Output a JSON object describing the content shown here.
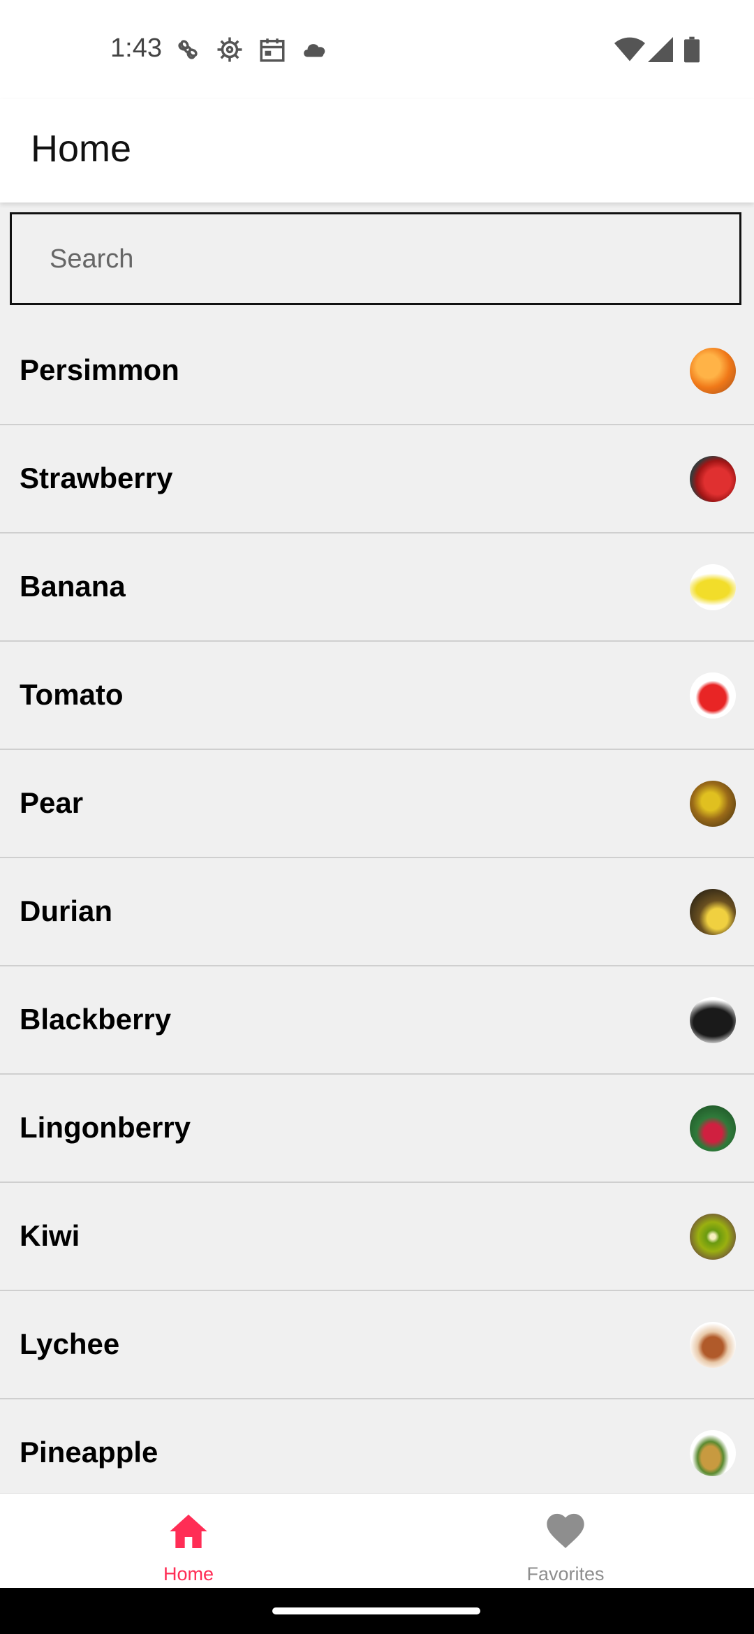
{
  "status_bar": {
    "time": "1:43",
    "icons": [
      "fan-icon",
      "settings-gear-icon",
      "calendar-icon",
      "cloud-icon",
      "wifi-icon",
      "signal-icon",
      "battery-icon"
    ]
  },
  "app_bar": {
    "title": "Home"
  },
  "search": {
    "placeholder": "Search",
    "value": ""
  },
  "list": {
    "items": [
      {
        "label": "Persimmon",
        "thumb": "persimmon-image"
      },
      {
        "label": "Strawberry",
        "thumb": "strawberry-image"
      },
      {
        "label": "Banana",
        "thumb": "banana-image"
      },
      {
        "label": "Tomato",
        "thumb": "tomato-image"
      },
      {
        "label": "Pear",
        "thumb": "pear-image"
      },
      {
        "label": "Durian",
        "thumb": "durian-image"
      },
      {
        "label": "Blackberry",
        "thumb": "blackberry-image"
      },
      {
        "label": "Lingonberry",
        "thumb": "lingonberry-image"
      },
      {
        "label": "Kiwi",
        "thumb": "kiwi-image"
      },
      {
        "label": "Lychee",
        "thumb": "lychee-image"
      },
      {
        "label": "Pineapple",
        "thumb": "pineapple-image"
      }
    ]
  },
  "bottom_nav": {
    "home_label": "Home",
    "favorites_label": "Favorites",
    "active": "home"
  },
  "colors": {
    "accent": "#ff2d55",
    "inactive": "#8e8e8e",
    "list_background": "#f0f0f0"
  }
}
